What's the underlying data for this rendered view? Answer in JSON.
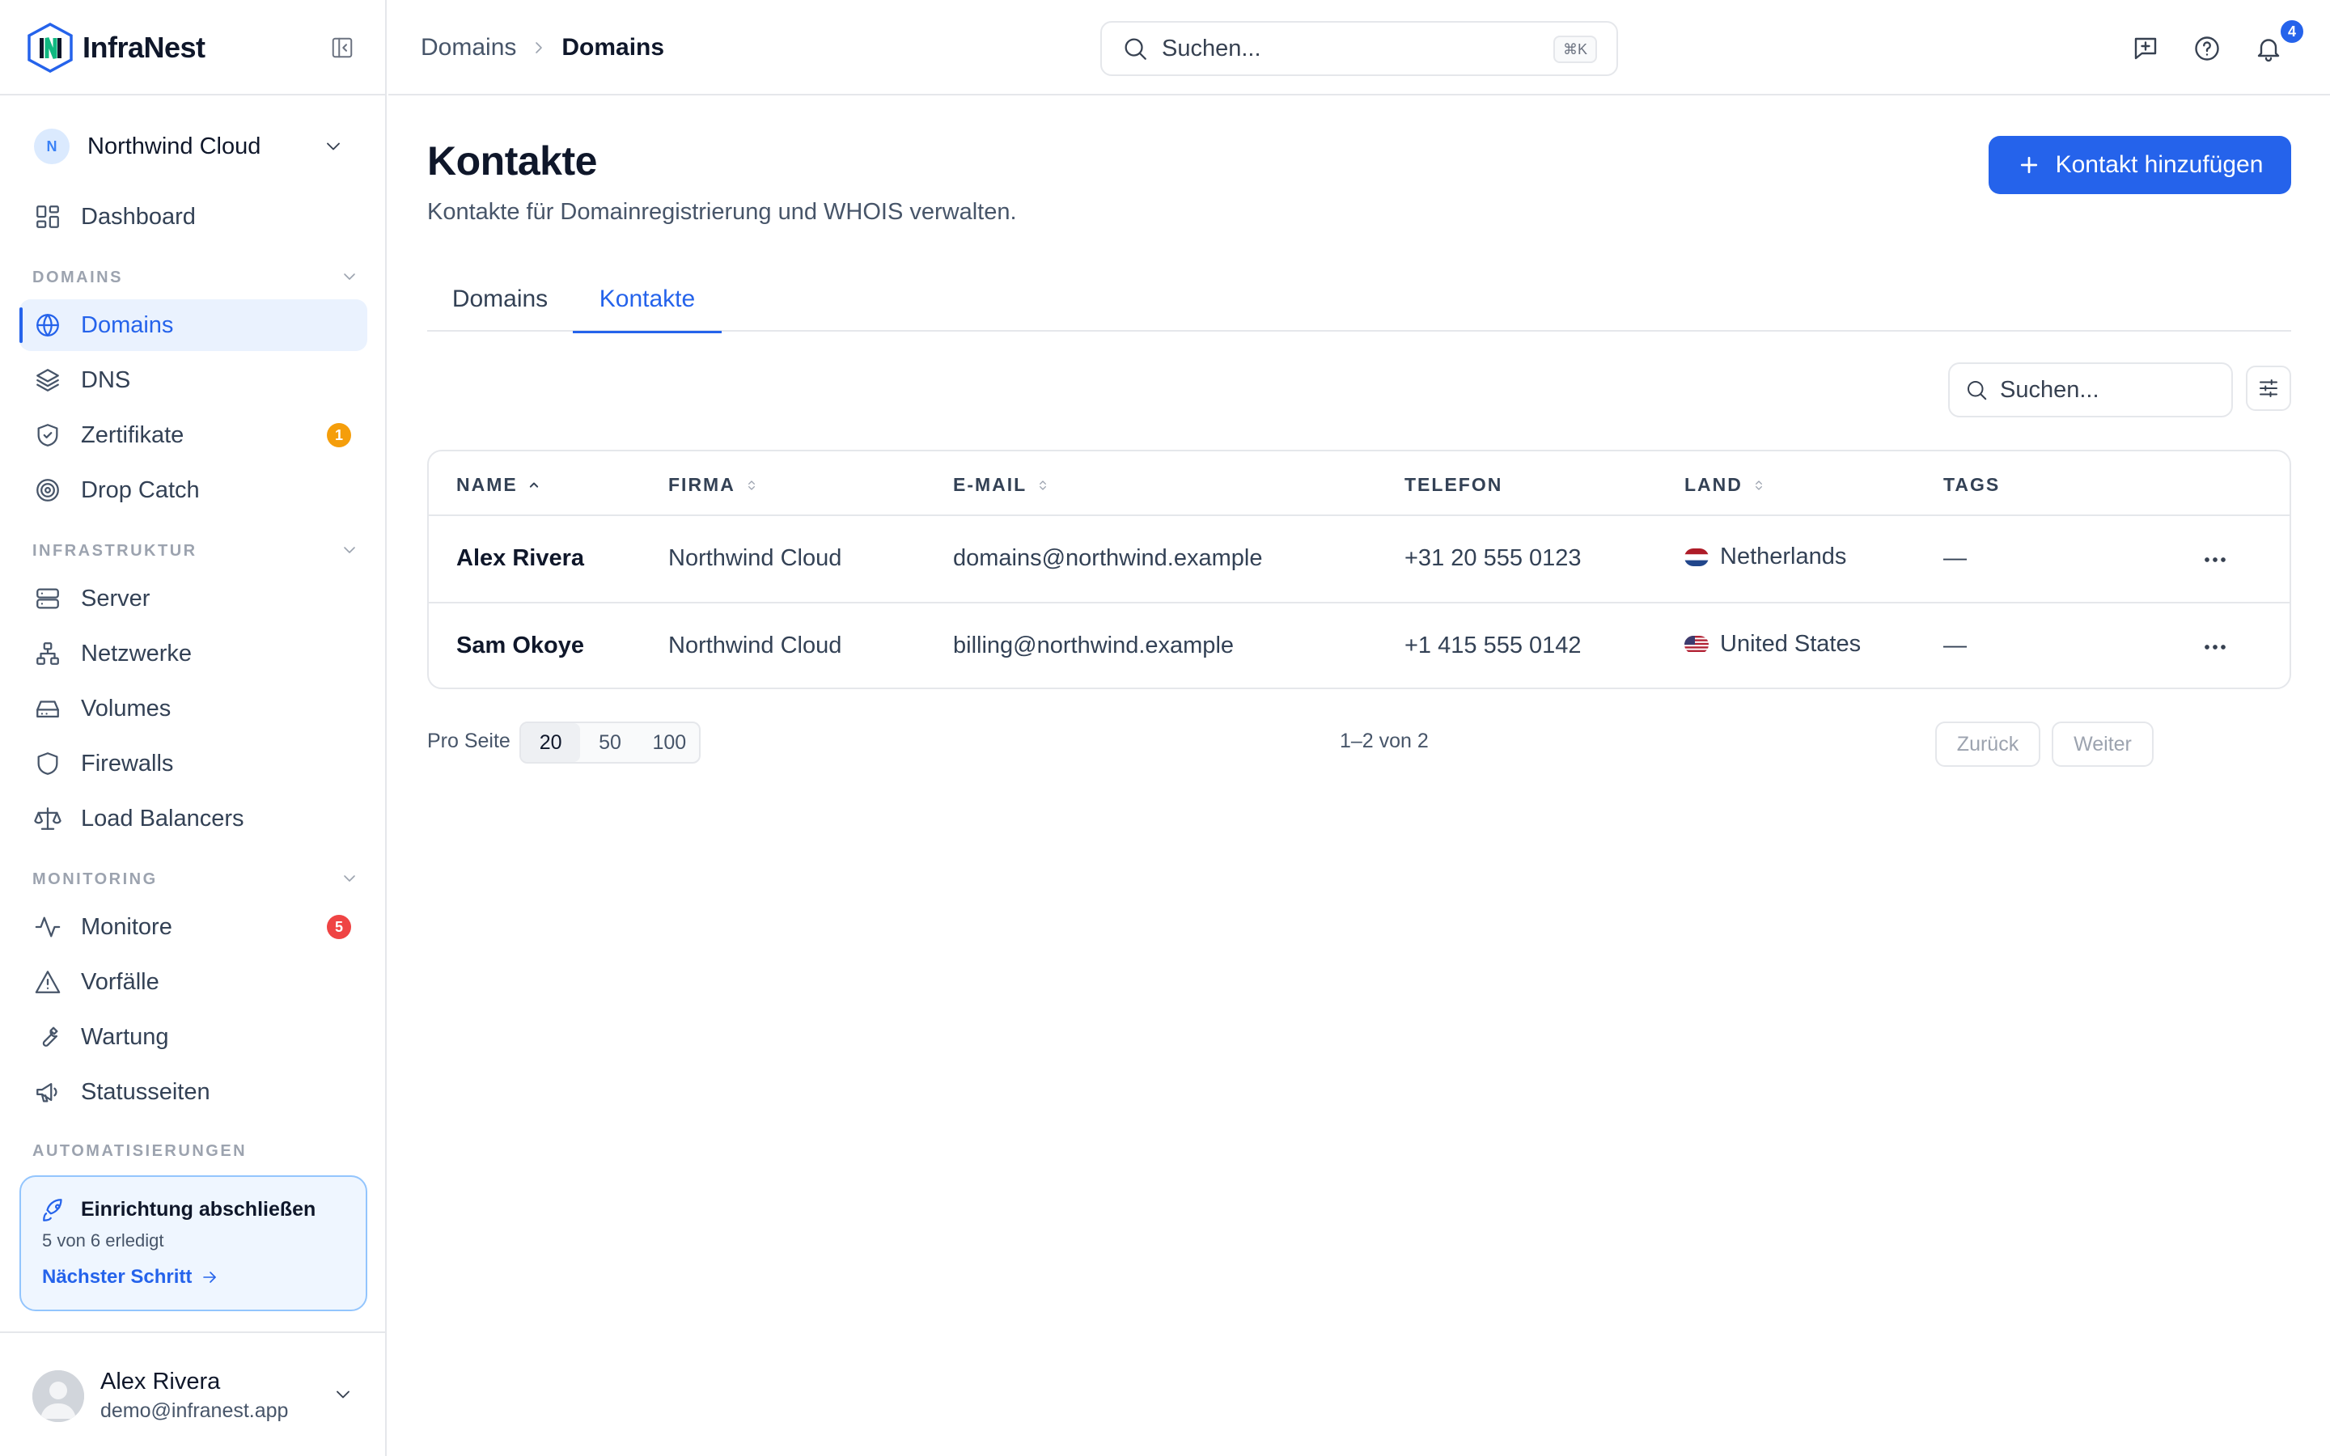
{
  "brand": {
    "name": "InfraNest",
    "accent": "#2563eb"
  },
  "org": {
    "initial": "N",
    "name": "Northwind Cloud"
  },
  "nav": {
    "dashboard": "Dashboard",
    "sections": {
      "domains": "DOMAINS",
      "infra": "INFRASTRUKTUR",
      "monitoring": "MONITORING",
      "automation": "AUTOMATISIERUNGEN"
    },
    "domains": "Domains",
    "dns": "DNS",
    "certificates": "Zertifikate",
    "certificates_badge": "1",
    "dropcatch": "Drop Catch",
    "server": "Server",
    "networks": "Netzwerke",
    "volumes": "Volumes",
    "firewalls": "Firewalls",
    "loadbalancers": "Load Balancers",
    "monitors": "Monitore",
    "monitors_badge": "5",
    "incidents": "Vorfälle",
    "maintenance": "Wartung",
    "statuspages": "Statusseiten"
  },
  "setup": {
    "title": "Einrichtung abschließen",
    "progress": "5 von 6 erledigt",
    "link": "Nächster Schritt"
  },
  "user": {
    "name": "Alex Rivera",
    "email": "demo@infranest.app"
  },
  "topbar": {
    "breadcrumb": [
      "Domains",
      "Domains"
    ],
    "search_placeholder": "Suchen...",
    "shortcut": "⌘K",
    "notifications_count": "4"
  },
  "page": {
    "title": "Kontakte",
    "subtitle": "Kontakte für Domainregistrierung und WHOIS verwalten.",
    "add_button": "Kontakt hinzufügen",
    "tabs": [
      "Domains",
      "Kontakte"
    ],
    "active_tab": "Kontakte",
    "table_search_placeholder": "Suchen..."
  },
  "table": {
    "columns": [
      "NAME",
      "FIRMA",
      "E-MAIL",
      "TELEFON",
      "LAND",
      "TAGS"
    ],
    "rows": [
      {
        "name": "Alex Rivera",
        "company": "Northwind Cloud",
        "email": "domains@northwind.example",
        "phone": "+31 20 555 0123",
        "country": "Netherlands",
        "flag": "nl",
        "tags": "—"
      },
      {
        "name": "Sam Okoye",
        "company": "Northwind Cloud",
        "email": "billing@northwind.example",
        "phone": "+1 415 555 0142",
        "country": "United States",
        "flag": "us",
        "tags": "—"
      }
    ]
  },
  "pagination": {
    "per_page_label": "Pro Seite",
    "sizes": [
      "20",
      "50",
      "100"
    ],
    "selected": "20",
    "count": "1–2 von 2",
    "prev": "Zurück",
    "next": "Weiter"
  },
  "colors": {
    "primary": "#2563eb",
    "badge_warning": "#f59e0b",
    "badge_danger": "#ef4444",
    "active_bg": "#eaf2fe"
  },
  "icons": {
    "dashboard": "grid-icon",
    "domains": "globe-icon",
    "dns": "layers-icon",
    "certificates": "shield-check-icon",
    "dropcatch": "target-icon",
    "server": "server-icon",
    "networks": "network-icon",
    "volumes": "hard-drive-icon",
    "firewalls": "shield-icon",
    "loadbalancers": "scale-icon",
    "monitors": "activity-icon",
    "incidents": "alert-triangle-icon",
    "maintenance": "wrench-icon",
    "statuspages": "megaphone-icon"
  }
}
